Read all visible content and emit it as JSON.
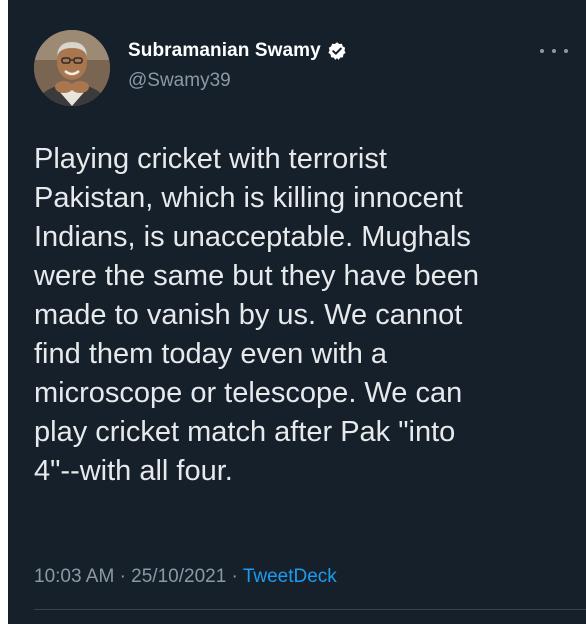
{
  "author": {
    "display_name": "Subramanian Swamy",
    "handle": "@Swamy39",
    "verified_icon": "verified-badge-icon",
    "avatar": "profile-photo"
  },
  "more_icon": "ellipsis-icon",
  "tweet": {
    "lines": [
      "Playing cricket with terrorist",
      "Pakistan, which is killing innocent",
      "Indians, is unacceptable. Mughals",
      "were the same but they have been",
      "made to vanish by us. We cannot",
      "find them today even with a",
      "microscope or telescope. We can",
      "play cricket match after Pak \"into",
      "4\"--with all four."
    ]
  },
  "meta": {
    "time": "10:03 AM",
    "separator": "·",
    "date": "25/10/2021",
    "source": "TweetDeck"
  },
  "colors": {
    "background": "#15202b",
    "text": "#e7e9ea",
    "secondary": "#8b98a5",
    "link": "#1d9bf0",
    "divider": "#38444d"
  }
}
